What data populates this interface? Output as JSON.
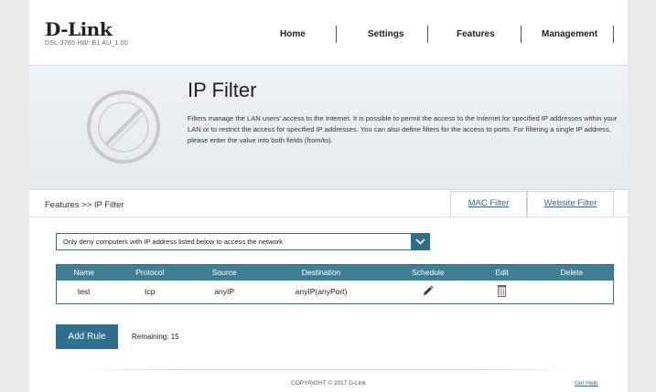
{
  "brand": {
    "logo": "D-Link",
    "model_info": "DSL-3785  HW: B1  AU_1.00"
  },
  "nav": {
    "home": "Home",
    "settings": "Settings",
    "features": "Features",
    "management": "Management"
  },
  "page": {
    "title": "IP Filter",
    "description": "Filters manage the LAN users' access to the Internet. It is possible to permit the access to the Internet for specified IP addresses within your LAN or to restrict the access for specified IP addresses. You can also define filters for the access to ports. For filtering a single IP address, please enter the value into both fields (from/to)."
  },
  "breadcrumb": "Features >> IP Filter",
  "tabs": {
    "mac_filter": "MAC Filter",
    "website_filter": "Website Filter"
  },
  "filter_mode": {
    "selected": "Only deny computers with IP address listed below to access the network"
  },
  "table": {
    "headers": {
      "name": "Name",
      "protocol": "Protocol",
      "source": "Source",
      "destination": "Destination",
      "schedule": "Schedule",
      "edit": "Edit",
      "delete": "Delete"
    },
    "rows": [
      {
        "name": "test",
        "protocol": "tcp",
        "source": "anyIP",
        "destination": "anyIP(anyPort)",
        "schedule_icon": "pencil-icon",
        "edit_icon": "trash-icon"
      }
    ]
  },
  "actions": {
    "add_rule": "Add Rule",
    "remaining": "Remaining: 15"
  },
  "footer": {
    "copyright": "COPYRIGHT © 2017 D-Link",
    "help": "Get Help"
  },
  "colors": {
    "accent": "#2e6f8e",
    "table_header": "#3f7f96",
    "banner": "#eef2f4"
  }
}
